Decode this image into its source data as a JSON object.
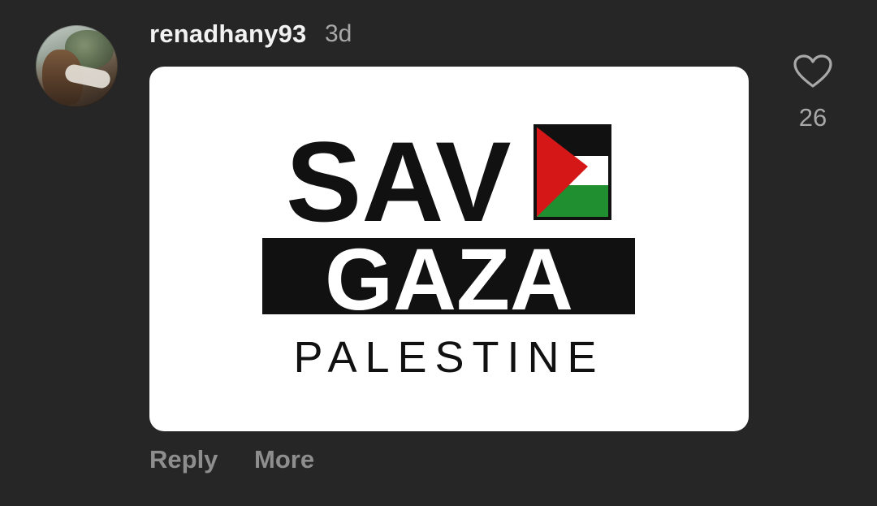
{
  "comment": {
    "username": "renadhany93",
    "timestamp": "3d",
    "like_count": "26",
    "actions": {
      "reply_label": "Reply",
      "more_label": "More"
    }
  },
  "image": {
    "line1": "SAV",
    "line2": "GAZA",
    "line3": "PALESTINE",
    "flag_colors": {
      "black": "#111111",
      "white": "#ffffff",
      "green": "#1f8f2f",
      "red": "#d51717"
    }
  },
  "icons": {
    "like": "heart-outline-icon",
    "avatar": "user-avatar"
  }
}
